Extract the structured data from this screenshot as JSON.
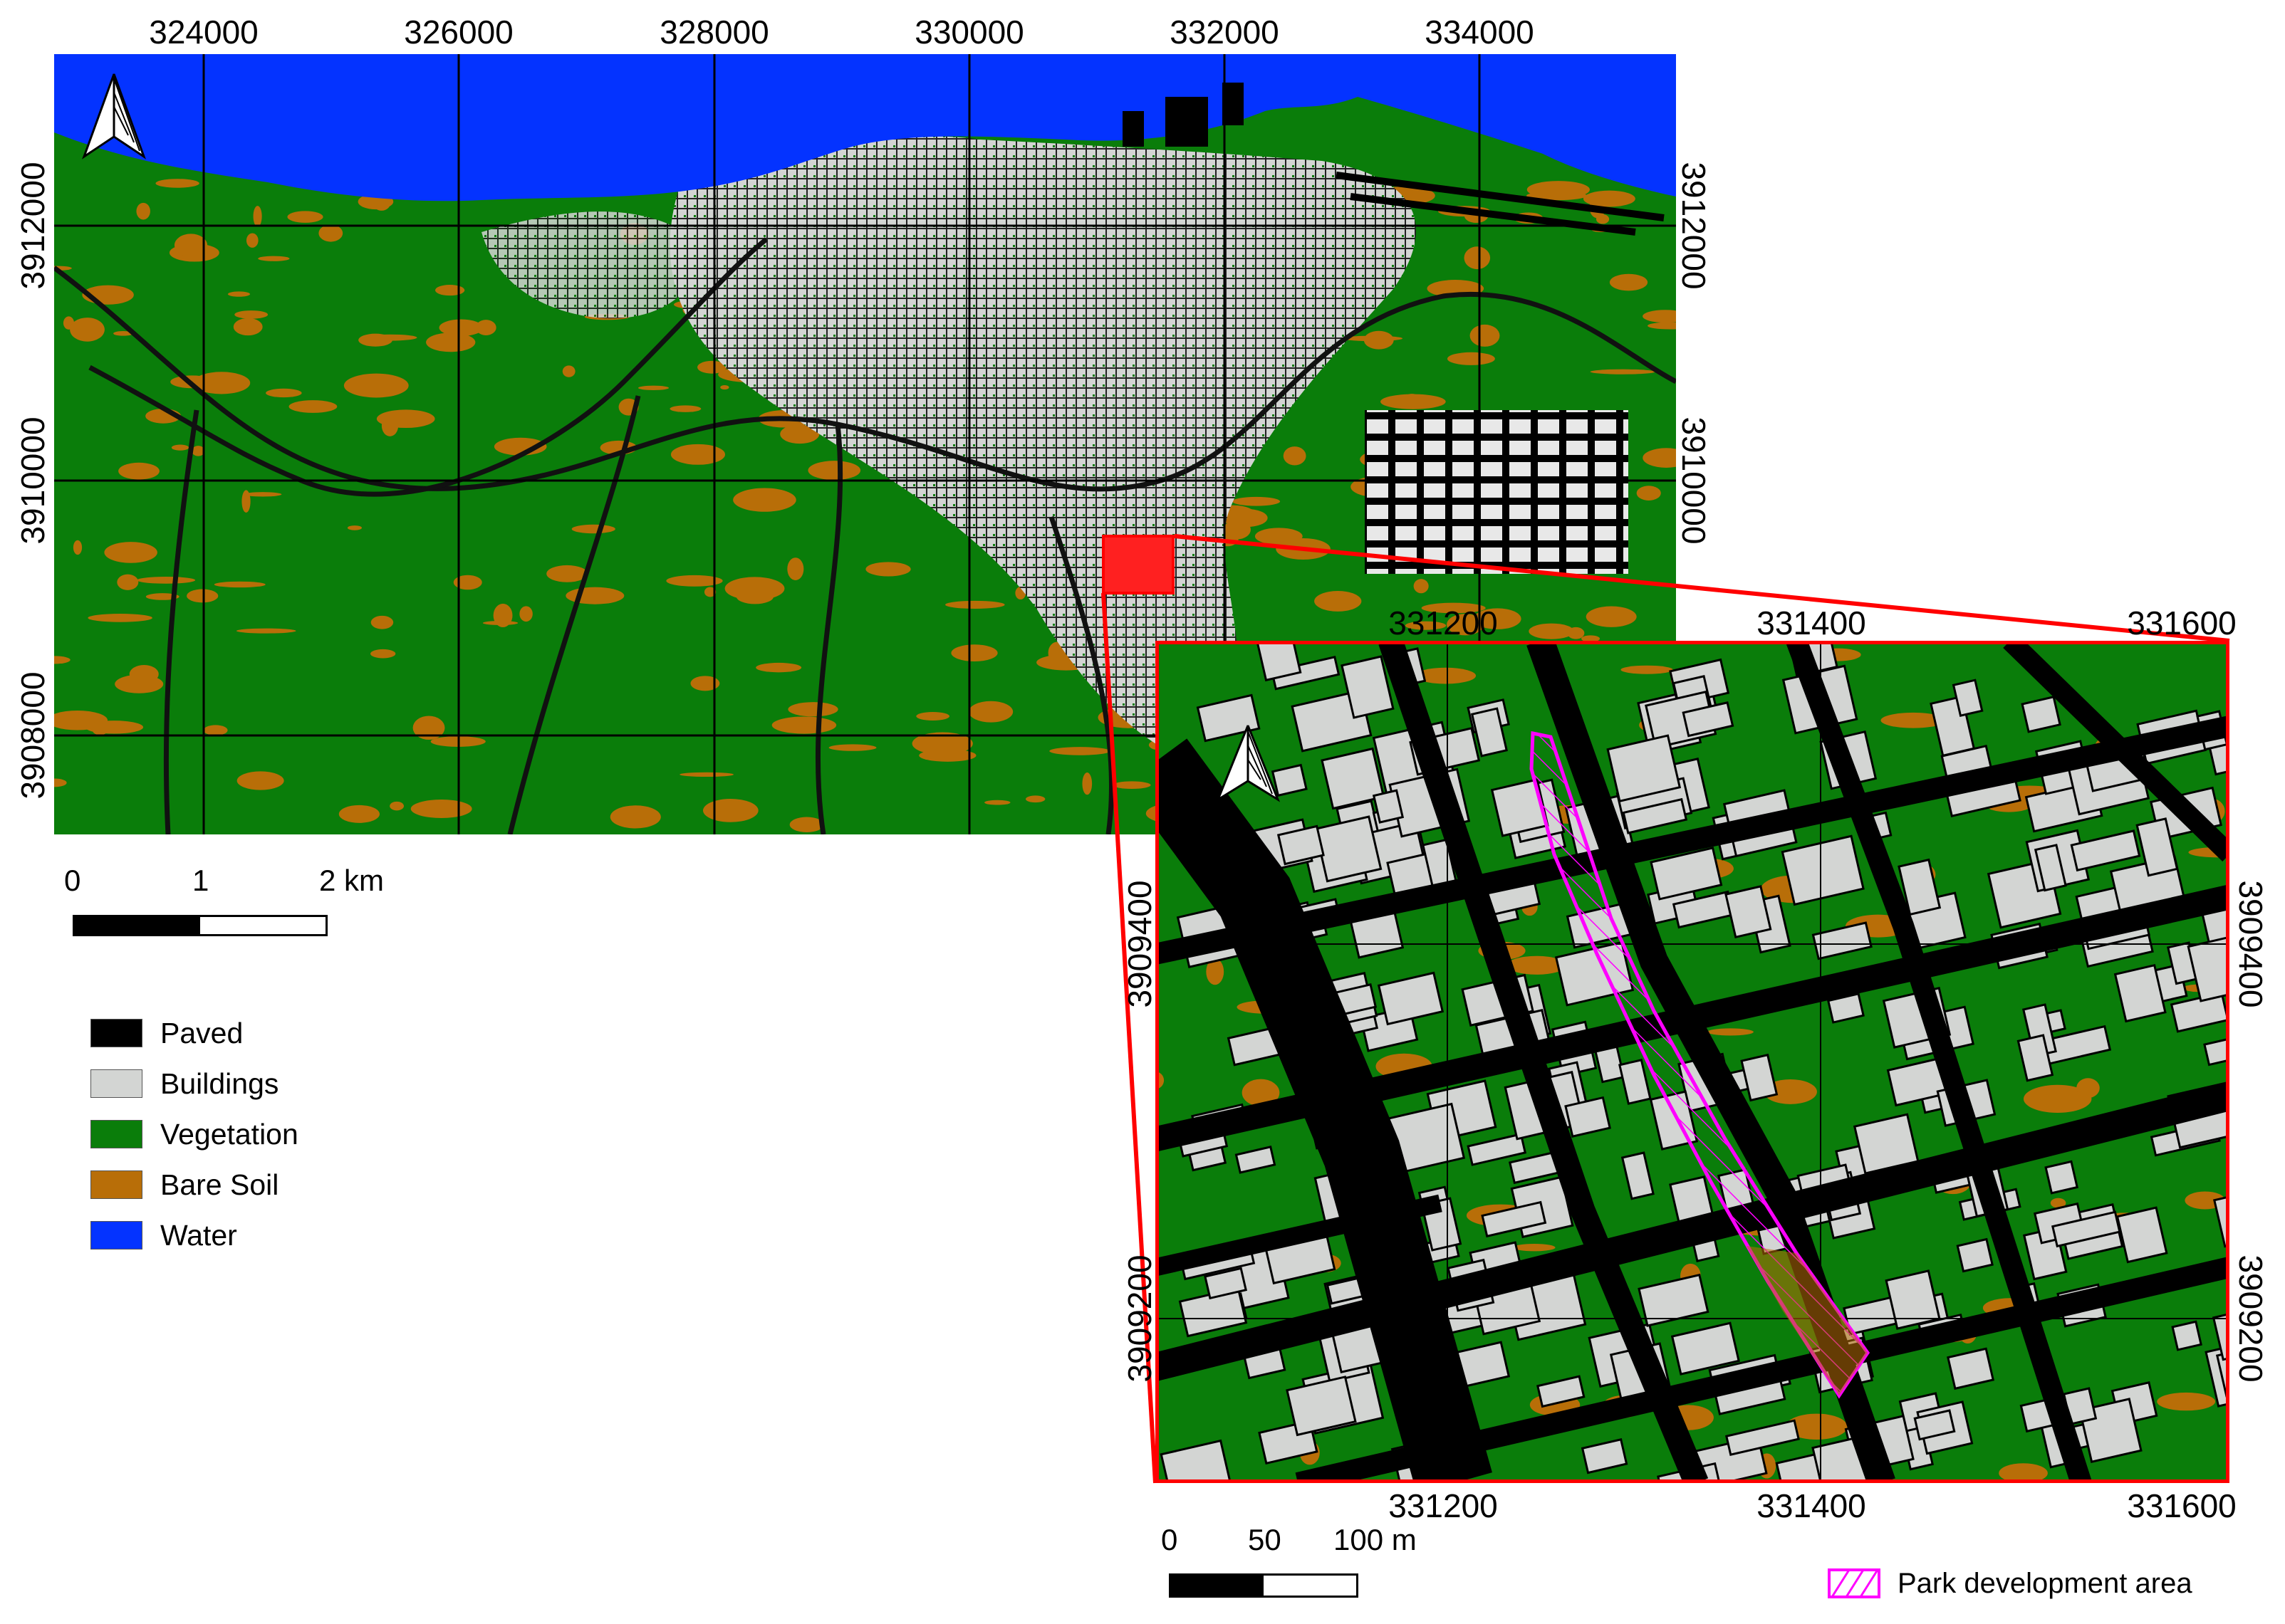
{
  "main_map": {
    "x_ticks": [
      "324000",
      "326000",
      "328000",
      "330000",
      "332000",
      "334000"
    ],
    "y_ticks": [
      "3912000",
      "3910000",
      "3908000"
    ],
    "scale_bar": {
      "labels": [
        "0",
        "1",
        "2 km"
      ]
    },
    "north_arrow": "north-arrow-icon"
  },
  "inset_map": {
    "x_ticks": [
      "331200",
      "331400",
      "331600"
    ],
    "y_ticks": [
      "3909400",
      "3909200"
    ],
    "scale_bar": {
      "labels": [
        "0",
        "50",
        "100 m"
      ]
    },
    "north_arrow": "north-arrow-icon",
    "frame_color": "#ff0000"
  },
  "legend": {
    "items": [
      {
        "label": "Paved",
        "color": "#000000"
      },
      {
        "label": "Buildings",
        "color": "#d3d5d3"
      },
      {
        "label": "Vegetation",
        "color": "#0a7d0a"
      },
      {
        "label": "Bare Soil",
        "color": "#b86e08"
      },
      {
        "label": "Water",
        "color": "#0433ff"
      }
    ],
    "park": {
      "label": "Park development area",
      "color": "#ff00ff"
    }
  }
}
